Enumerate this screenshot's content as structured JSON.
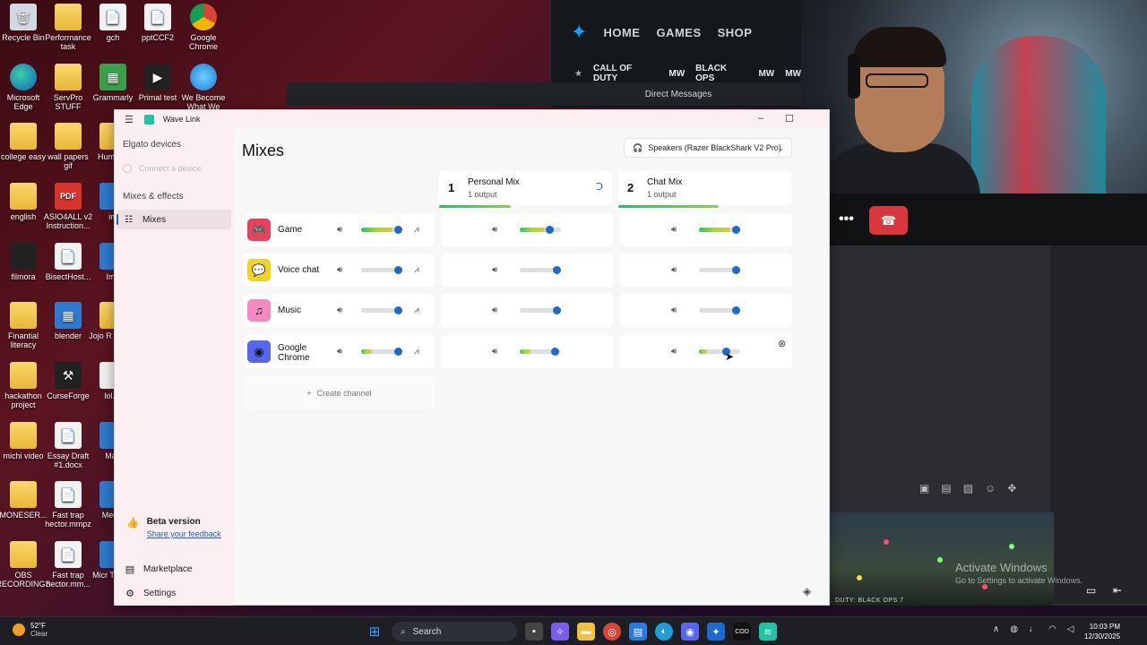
{
  "desktop": {
    "icons": [
      {
        "label": "Recycle Bin",
        "glyph": "🗑"
      },
      {
        "label": "Performance task",
        "glyph": ""
      },
      {
        "label": "gch",
        "glyph": "📄"
      },
      {
        "label": "pptCCF2",
        "glyph": "📄"
      },
      {
        "label": "Google Chrome",
        "glyph": ""
      },
      {
        "label": "Microsoft Edge",
        "glyph": ""
      },
      {
        "label": "ServPro STUFF",
        "glyph": ""
      },
      {
        "label": "Grammarly",
        "glyph": "▦"
      },
      {
        "label": "Primal test",
        "glyph": "▶"
      },
      {
        "label": "We Become What We",
        "glyph": ""
      },
      {
        "label": "college easy",
        "glyph": ""
      },
      {
        "label": "wall papers gif",
        "glyph": ""
      },
      {
        "label": "Huma Fi",
        "glyph": ""
      },
      {
        "label": "english",
        "glyph": ""
      },
      {
        "label": "ASIO4ALL v2 Instruction...",
        "glyph": "PDF"
      },
      {
        "label": "im",
        "glyph": ""
      },
      {
        "label": "filmora",
        "glyph": ""
      },
      {
        "label": "BisectHost...",
        "glyph": "📄"
      },
      {
        "label": "Ima",
        "glyph": ""
      },
      {
        "label": "Finantial literacy",
        "glyph": ""
      },
      {
        "label": "blender",
        "glyph": "▦"
      },
      {
        "label": "Jojo R quiz R",
        "glyph": ""
      },
      {
        "label": "hackathon project",
        "glyph": ""
      },
      {
        "label": "CurseForge",
        "glyph": "⚒"
      },
      {
        "label": "lol.m",
        "glyph": ""
      },
      {
        "label": "michi video",
        "glyph": ""
      },
      {
        "label": "Essay Draft #1.docx",
        "glyph": "📄"
      },
      {
        "label": "Man",
        "glyph": ""
      },
      {
        "label": "MONESER...",
        "glyph": ""
      },
      {
        "label": "Fast trap hector.mmpz",
        "glyph": "📄"
      },
      {
        "label": "Media",
        "glyph": ""
      },
      {
        "label": "OBS RECORDINGS",
        "glyph": ""
      },
      {
        "label": "Fast trap hector.mm...",
        "glyph": "📄"
      },
      {
        "label": "Micr Teams",
        "glyph": ""
      }
    ]
  },
  "launcher": {
    "nav": [
      "HOME",
      "GAMES",
      "SHOP"
    ],
    "games": [
      "CALL OF DUTY",
      "MW",
      "BLACK OPS",
      "MW",
      "MW"
    ],
    "direct_messages": "Direct Messages"
  },
  "discord": {
    "more": "•••",
    "hangup": "☎",
    "toolbar": [
      "▣",
      "▤",
      "▧",
      "☺",
      "✥"
    ],
    "game_caption": "DUTY: BLACK OPS 7"
  },
  "activation": {
    "line1": "Activate Windows",
    "line2": "Go to Settings to activate Windows."
  },
  "wavelink": {
    "app_title": "Wave Link",
    "sidebar": {
      "devices_header": "Elgato devices",
      "connect_device": "Connect a device",
      "mixes_header": "Mixes & effects",
      "mixes_item": "Mixes",
      "beta_title": "Beta version",
      "feedback_link": "Share your feedback",
      "marketplace": "Marketplace",
      "settings": "Settings"
    },
    "page_title": "Mixes",
    "output_device": "Speakers (Razer BlackShark V2 Pro)",
    "mixes": [
      {
        "number": "1",
        "name": "Personal Mix",
        "outputs": "1 output"
      },
      {
        "number": "2",
        "name": "Chat Mix",
        "outputs": "1 output"
      }
    ],
    "channels": [
      {
        "name": "Game",
        "icon": "🎮",
        "color": "#e8425a",
        "levels": [
          0.9,
          0.72,
          0.89
        ]
      },
      {
        "name": "Voice chat",
        "icon": "💬",
        "color": "#f2d324",
        "levels": [
          0.9,
          0.89,
          0.89
        ]
      },
      {
        "name": "Music",
        "icon": "♫",
        "color": "#f48bc0",
        "levels": [
          0.9,
          0.89,
          0.89
        ]
      },
      {
        "name": "Google Chrome",
        "icon": "◉",
        "color": "#5865f2",
        "levels": [
          0.9,
          0.85,
          0.65
        ]
      }
    ],
    "create_channel": "Create channel"
  },
  "taskbar": {
    "temperature": "52°F",
    "condition": "Clear",
    "search": "Search",
    "time": "10:03 PM",
    "date": "12/30/2025"
  }
}
